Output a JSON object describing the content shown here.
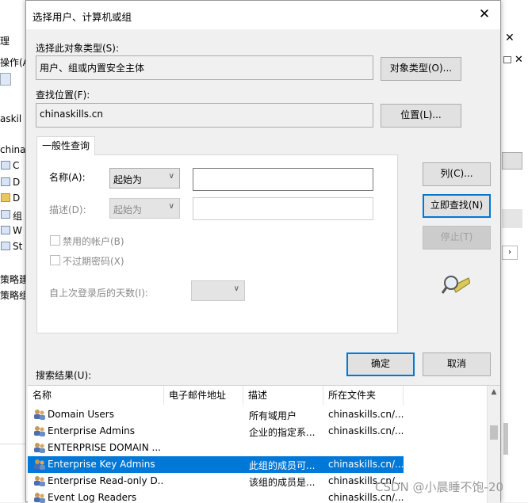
{
  "dialog": {
    "title": "选择用户、计算机或组",
    "object_type_label": "选择此对象类型(S):",
    "object_type_value": "用户、组或内置安全主体",
    "object_type_button": "对象类型(O)...",
    "location_label": "查找位置(F):",
    "location_value": "chinaskills.cn",
    "location_button": "位置(L)...",
    "tab_label": "一般性查询",
    "name_label": "名称(A):",
    "name_mode": "起始为",
    "desc_label": "描述(D):",
    "desc_mode": "起始为",
    "disabled_accounts_label": "禁用的帐户(B)",
    "no_expire_label": "不过期密码(X)",
    "days_label": "自上次登录后的天数(I):",
    "columns_button": "列(C)...",
    "find_now_button": "立即查找(N)",
    "stop_button": "停止(T)",
    "ok_button": "确定",
    "cancel_button": "取消",
    "results_label": "搜索结果(U):",
    "close_glyph": "✕"
  },
  "results": {
    "headers": [
      "名称",
      "电子邮件地址",
      "描述",
      "所在文件夹"
    ],
    "rows": [
      {
        "name": "Domain Users",
        "email": "",
        "desc": "所有域用户",
        "folder": "chinaskills.cn/...",
        "selected": false
      },
      {
        "name": "Enterprise Admins",
        "email": "",
        "desc": "企业的指定系...",
        "folder": "chinaskills.cn/...",
        "selected": false
      },
      {
        "name": "ENTERPRISE DOMAIN ...",
        "email": "",
        "desc": "",
        "folder": "",
        "selected": false
      },
      {
        "name": "Enterprise Key Admins",
        "email": "",
        "desc": "此组的成员可...",
        "folder": "chinaskills.cn/...",
        "selected": true
      },
      {
        "name": "Enterprise Read-only D...",
        "email": "",
        "desc": "该组的成员是...",
        "folder": "chinaskills.cn/...",
        "selected": false
      },
      {
        "name": "Event Log Readers",
        "email": "",
        "desc": "",
        "folder": "chinaskills.cn/...",
        "selected": false
      }
    ]
  },
  "background": {
    "left_fragments": [
      "理",
      "操作(A)",
      "askil",
      "china",
      "C",
      "D",
      "D",
      "组",
      "W",
      "St",
      "",
      "策略建",
      "策略组"
    ],
    "right_close": "✕"
  },
  "watermark": "CSDN @小晨睡不饱-20",
  "colors": {
    "accent": "#0078d7",
    "dialog_bg": "#f0f0f0"
  }
}
